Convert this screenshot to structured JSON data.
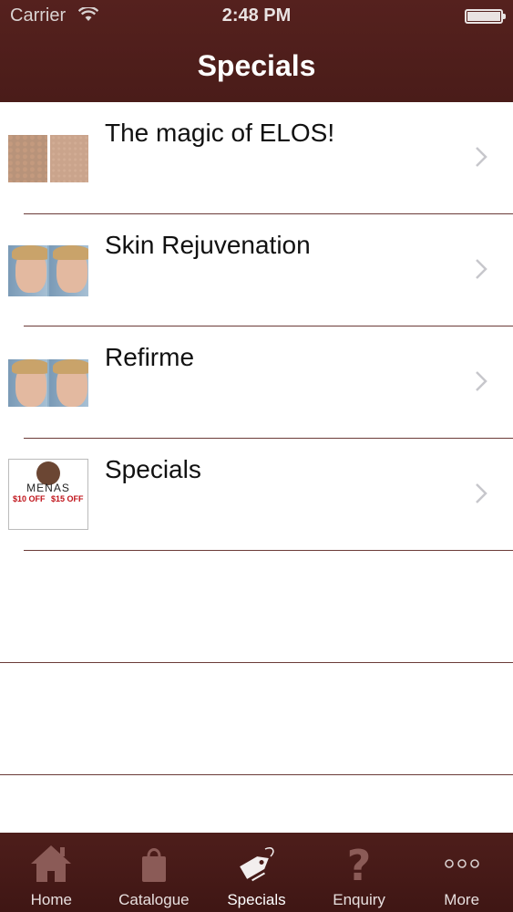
{
  "status_bar": {
    "carrier": "Carrier",
    "time": "2:48 PM"
  },
  "nav": {
    "title": "Specials"
  },
  "list": {
    "items": [
      {
        "label": "The magic of ELOS!",
        "thumb": "legs-before-after"
      },
      {
        "label": "Skin Rejuvenation",
        "thumb": "face-before-after"
      },
      {
        "label": "Refirme",
        "thumb": "face-before-after"
      },
      {
        "label": "Specials",
        "thumb": "menas-ad",
        "ad_brand": "MENAS",
        "ad_offer_1": "$10 OFF",
        "ad_offer_2": "$15 OFF"
      }
    ]
  },
  "tabs": [
    {
      "label": "Home",
      "icon": "home-icon"
    },
    {
      "label": "Catalogue",
      "icon": "shopping-bag-icon"
    },
    {
      "label": "Specials",
      "icon": "price-tag-icon",
      "active": true
    },
    {
      "label": "Enquiry",
      "icon": "question-mark-icon"
    },
    {
      "label": "More",
      "icon": "more-dots-icon"
    }
  ],
  "colors": {
    "bar_background": "#4e1e1b",
    "separator": "#6b3b38",
    "chevron": "#c7c7cc"
  }
}
